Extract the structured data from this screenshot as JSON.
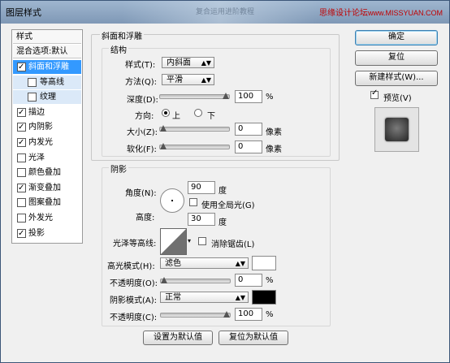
{
  "window": {
    "title": "图层样式",
    "blurred_title": "复合运用进阶教程",
    "watermark_cn": "思缘设计论坛",
    "watermark_url": "www.MISSYUAN.COM"
  },
  "left_panel": {
    "header": "样式",
    "blend": "混合选项:默认",
    "items": [
      {
        "label": "斜面和浮雕",
        "checked": true,
        "selected": true
      },
      {
        "label": "等高线",
        "checked": false,
        "sub": true
      },
      {
        "label": "纹理",
        "checked": false,
        "sub": true
      },
      {
        "label": "描边",
        "checked": true
      },
      {
        "label": "内阴影",
        "checked": true
      },
      {
        "label": "内发光",
        "checked": true
      },
      {
        "label": "光泽",
        "checked": false
      },
      {
        "label": "颜色叠加",
        "checked": false
      },
      {
        "label": "渐变叠加",
        "checked": true
      },
      {
        "label": "图案叠加",
        "checked": false
      },
      {
        "label": "外发光",
        "checked": false
      },
      {
        "label": "投影",
        "checked": true
      }
    ]
  },
  "bevel": {
    "title": "斜面和浮雕",
    "structure": "结构",
    "style_label": "样式(T):",
    "style_value": "内斜面",
    "technique_label": "方法(Q):",
    "technique_value": "平滑",
    "depth_label": "深度(D):",
    "depth_value": "100",
    "depth_level": 1.0,
    "percent": "%",
    "direction_label": "方向:",
    "up_label": "上",
    "down_label": "下",
    "direction_value": "上",
    "size_label": "大小(Z):",
    "size_value": "0",
    "size_level": 0.0,
    "soften_label": "软化(F):",
    "soften_value": "0",
    "soften_level": 0.0,
    "px": "像素"
  },
  "shading": {
    "title": "阴影",
    "angle_label": "角度(N):",
    "angle_value": "90",
    "degree": "度",
    "global_light_label": "使用全局光(G)",
    "global_light_checked": false,
    "altitude_label": "高度:",
    "altitude_value": "30",
    "gloss_label": "光泽等高线:",
    "antialias_label": "消除锯齿(L)",
    "antialias_checked": false,
    "highlight_label": "高光模式(H):",
    "highlight_value": "滤色",
    "highlight_color": "#ffffff",
    "hl_opacity_label": "不透明度(O):",
    "hl_opacity_value": "0",
    "hl_opacity_level": 0.0,
    "shadow_label": "阴影模式(A):",
    "shadow_value": "正常",
    "shadow_color": "#000000",
    "sh_opacity_label": "不透明度(C):",
    "sh_opacity_value": "100",
    "sh_opacity_level": 1.0,
    "percent": "%"
  },
  "bottom_buttons": {
    "set_default": "设置为默认值",
    "reset_default": "复位为默认值"
  },
  "right": {
    "ok": "确定",
    "reset": "复位",
    "new_style": "新建样式(W)...",
    "preview_label": "预览(V)",
    "preview_checked": true
  }
}
